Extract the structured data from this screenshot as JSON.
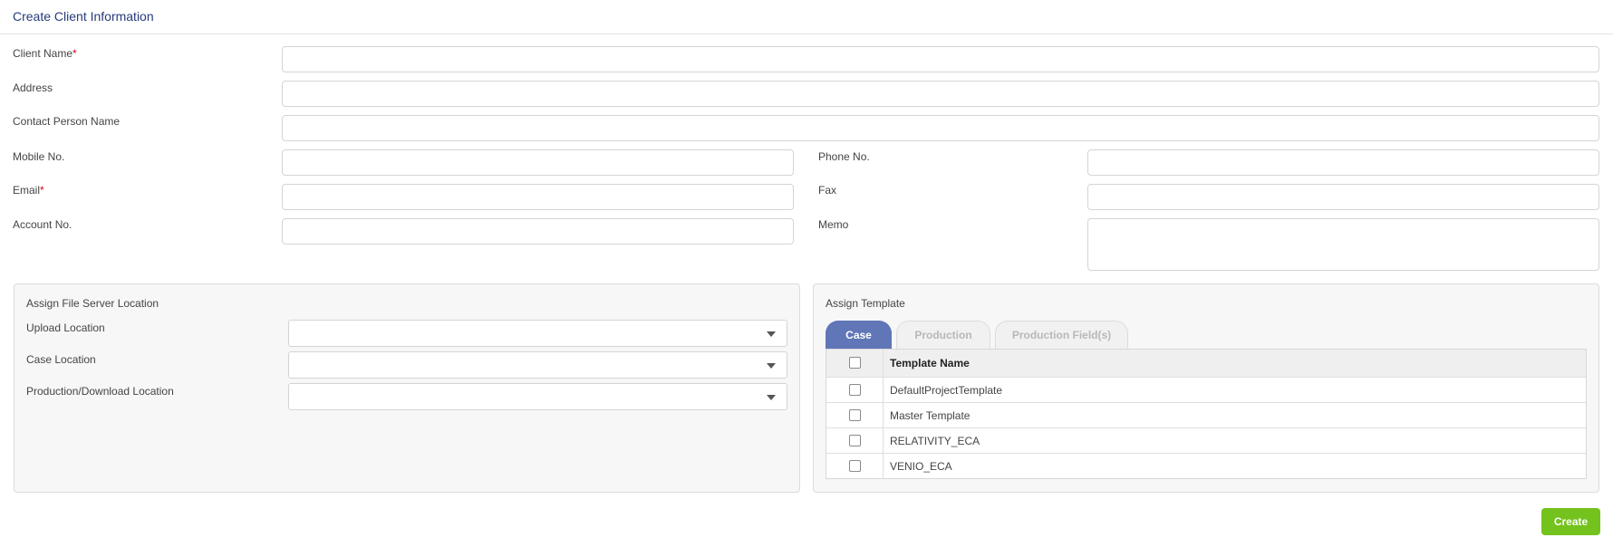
{
  "header": {
    "title": "Create Client Information"
  },
  "form": {
    "client_name_label": "Client Name",
    "required_mark": "*",
    "address_label": "Address",
    "contact_person_label": "Contact Person Name",
    "mobile_label": "Mobile No.",
    "phone_label": "Phone No.",
    "email_label": "Email",
    "fax_label": "Fax",
    "account_label": "Account No.",
    "memo_label": "Memo"
  },
  "file_server": {
    "title": "Assign File Server Location",
    "upload_label": "Upload Location",
    "case_label": "Case Location",
    "production_label": "Production/Download Location"
  },
  "template": {
    "title": "Assign Template",
    "tabs": [
      "Case",
      "Production",
      "Production Field(s)"
    ],
    "active_tab": "Case",
    "column_header": "Template Name",
    "rows": [
      "DefaultProjectTemplate",
      "Master Template",
      "RELATIVITY_ECA",
      "VENIO_ECA"
    ]
  },
  "actions": {
    "create_label": "Create"
  },
  "colors": {
    "accent": "#6076b7",
    "title": "#263a7a",
    "create": "#74c21d",
    "required": "#d0021b"
  }
}
